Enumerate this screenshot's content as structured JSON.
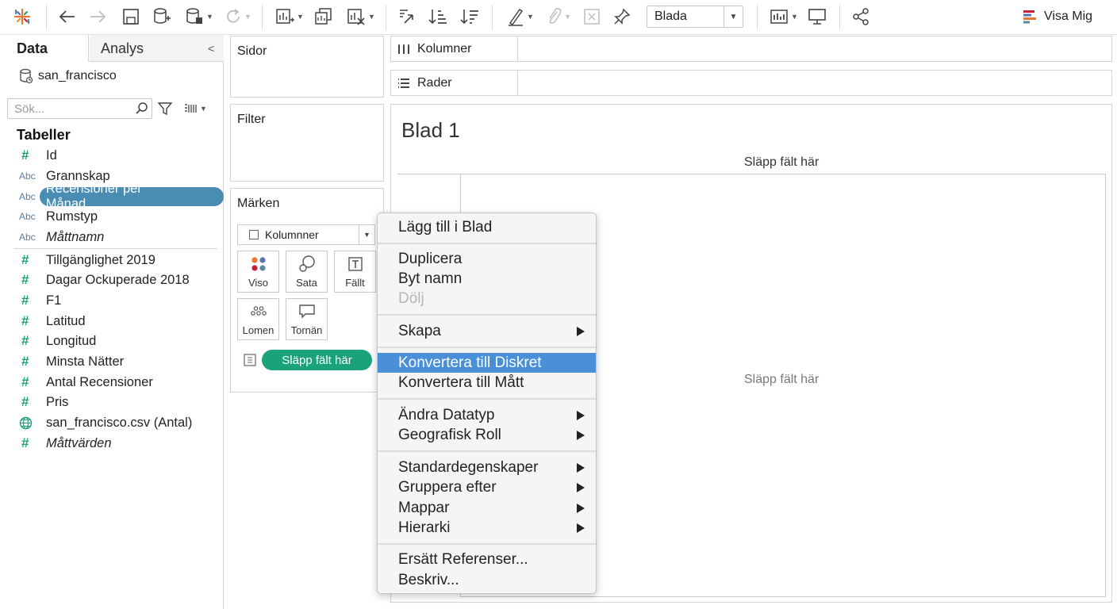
{
  "toolbar": {
    "sheet_select_value": "Blada",
    "show_me_label": "Visa Mig"
  },
  "left_pane": {
    "tab_data": "Data",
    "tab_analys": "Analys",
    "datasource": "san_francisco",
    "search_placeholder": "Sök...",
    "tables_title": "Tabeller",
    "fields": [
      {
        "type": "#",
        "name": "Id"
      },
      {
        "type": "Abc",
        "name": "Grannskap"
      },
      {
        "type": "Abc",
        "name": "Recensioner per Månad"
      },
      {
        "type": "Abc",
        "name": "Rumstyp"
      },
      {
        "type": "Abc",
        "name": "Måttnamn"
      },
      {
        "type": "#",
        "name": "Tillgänglighet 2019"
      },
      {
        "type": "#",
        "name": "Dagar Ockuperade 2018"
      },
      {
        "type": "#",
        "name": "F1"
      },
      {
        "type": "#",
        "name": "Latitud"
      },
      {
        "type": "#",
        "name": "Longitud"
      },
      {
        "type": "#",
        "name": "Minsta Nätter"
      },
      {
        "type": "#",
        "name": "Antal Recensioner"
      },
      {
        "type": "#",
        "name": "Pris"
      },
      {
        "type": "globe",
        "name": "san_francisco.csv (Antal)"
      },
      {
        "type": "#",
        "name": "Måttvärden"
      }
    ]
  },
  "cards": {
    "pages": "Sidor",
    "filter": "Filter",
    "marks": "Märken",
    "marks_type": "Kolumnner",
    "mark_buttons": [
      "Viso",
      "Sata",
      "Fällt",
      "Lomen",
      "Tornän"
    ],
    "drop_pill": "Släpp fält här"
  },
  "shelves": {
    "columns": "Kolumner",
    "rows": "Rader"
  },
  "canvas": {
    "sheet_title": "Blad 1",
    "drop_top": "Släpp fält här",
    "drop_center": "Släpp fält här"
  },
  "context_menu": {
    "items": [
      "Lägg till i Blad",
      "Duplicera",
      "Byt namn",
      "Dölj",
      "Skapa",
      "Konvertera till Diskret",
      "Konvertera till Mått",
      "Ändra Datatyp",
      "Geografisk Roll",
      "Standardegenskaper",
      "Gruppera efter",
      "Mappar",
      "Hierarki",
      "Ersätt Referenser...",
      "Beskriv..."
    ]
  }
}
